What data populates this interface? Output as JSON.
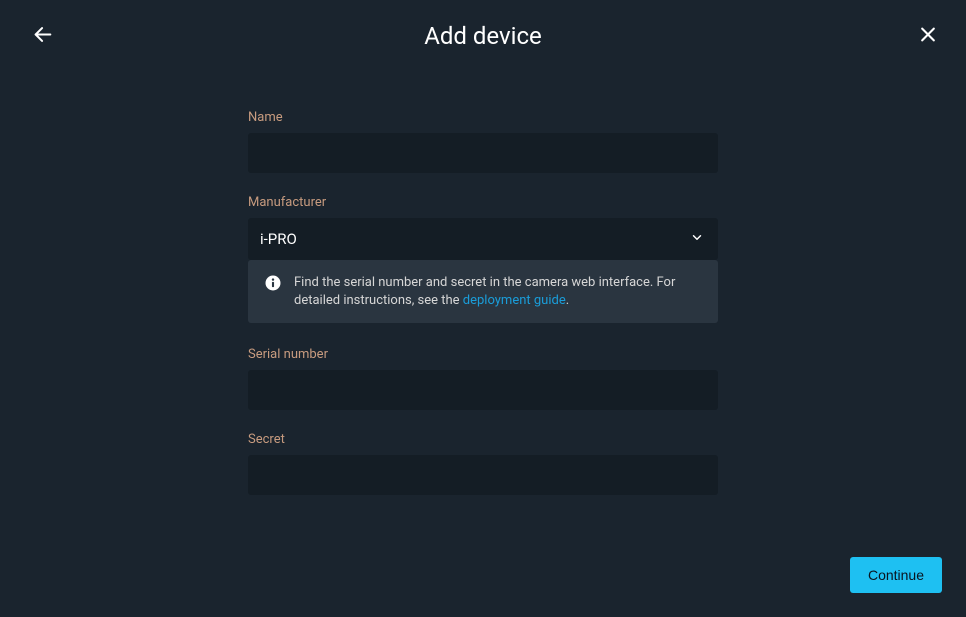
{
  "header": {
    "title": "Add device"
  },
  "form": {
    "name": {
      "label": "Name",
      "value": ""
    },
    "manufacturer": {
      "label": "Manufacturer",
      "value": "i-PRO"
    },
    "info": {
      "text_prefix": "Find the serial number and secret in the camera web interface. For detailed instructions, see the ",
      "link_text": "deployment guide",
      "text_suffix": "."
    },
    "serial": {
      "label": "Serial number",
      "value": ""
    },
    "secret": {
      "label": "Secret",
      "value": ""
    }
  },
  "footer": {
    "continue_label": "Continue"
  }
}
